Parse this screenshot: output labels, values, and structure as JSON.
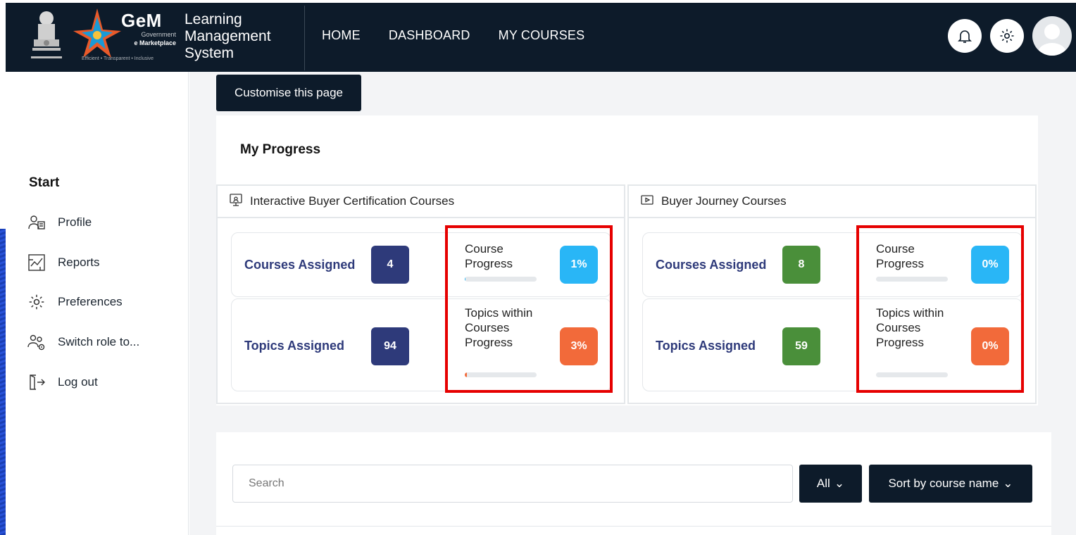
{
  "header": {
    "gem_title": "GeM",
    "gem_sub1": "Government",
    "gem_sub2": "e Marketplace",
    "gem_tagline": "Efficient • Transparent • Inclusive",
    "lms_title": "Learning Management System",
    "nav": [
      "HOME",
      "DASHBOARD",
      "MY COURSES"
    ]
  },
  "sidebar": {
    "title": "Start",
    "items": [
      {
        "label": "Profile",
        "icon": "profile-icon"
      },
      {
        "label": "Reports",
        "icon": "reports-icon"
      },
      {
        "label": "Preferences",
        "icon": "gear-icon"
      },
      {
        "label": "Switch role to...",
        "icon": "switch-role-icon"
      },
      {
        "label": "Log out",
        "icon": "logout-icon"
      }
    ]
  },
  "main": {
    "customise_label": "Customise this page",
    "progress_title": "My Progress",
    "panels": [
      {
        "title": "Interactive Buyer Certification Courses",
        "courses_assigned_label": "Courses Assigned",
        "courses_assigned": "4",
        "topics_assigned_label": "Topics Assigned",
        "topics_assigned": "94",
        "course_progress_label": "Course Progress",
        "course_progress": "1%",
        "course_progress_value": 1,
        "topics_progress_label": "Topics within Courses Progress",
        "topics_progress": "3%",
        "topics_progress_value": 3,
        "badge_color": "#2e3a7a"
      },
      {
        "title": "Buyer Journey Courses",
        "courses_assigned_label": "Courses Assigned",
        "courses_assigned": "8",
        "topics_assigned_label": "Topics Assigned",
        "topics_assigned": "59",
        "course_progress_label": "Course Progress",
        "course_progress": "0%",
        "course_progress_value": 0,
        "topics_progress_label": "Topics within Courses Progress",
        "topics_progress": "0%",
        "topics_progress_value": 0,
        "badge_color": "#4a8f3a"
      }
    ],
    "search_placeholder": "Search",
    "filter_label": "All",
    "sort_label": "Sort by course name"
  },
  "colors": {
    "header_bg": "#0d1b2a",
    "progress_blue": "#29b6f6",
    "progress_orange": "#f26a3a",
    "highlight_red": "#e60000"
  }
}
